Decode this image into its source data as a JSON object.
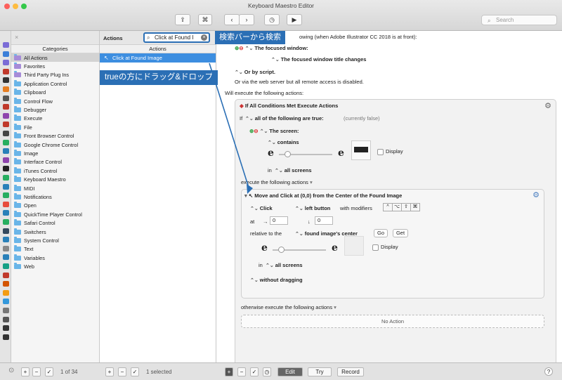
{
  "window": {
    "title": "Keyboard Maestro Editor",
    "toolbar": {
      "share_icon": "share-icon",
      "cmd_icon": "⌘",
      "back_icon": "‹",
      "fwd_icon": "›",
      "clock_icon": "clock-icon",
      "run_icon": "▶"
    },
    "search_placeholder": "Search"
  },
  "groups": {
    "header_close": "×",
    "column": "Categories",
    "items": [
      "All Actions",
      "Favorites",
      "Third Party Plug Ins",
      "Application Control",
      "Clipboard",
      "Control Flow",
      "Debugger",
      "Execute",
      "File",
      "Front Browser Control",
      "Google Chrome Control",
      "Image",
      "Interface Control",
      "iTunes Control",
      "Keyboard Maestro",
      "MIDI",
      "Notifications",
      "Open",
      "QuickTime Player Control",
      "Safari Control",
      "Switchers",
      "System Control",
      "Text",
      "Variables",
      "Web"
    ],
    "selected": "All Actions"
  },
  "actions": {
    "header": "Actions",
    "column": "Actions",
    "search_value": "Click at Found I",
    "found": "Click at Found Image"
  },
  "callouts": {
    "search": "検索バーから検索",
    "drag": "trueの方にドラッグ&ドロップ"
  },
  "editor": {
    "trigger_line": "owing (when Adobe Illustrator CC 2018 is at front):",
    "focused_window": "The focused window:",
    "title_changes": "The focused window title changes",
    "by_script": "Or by script.",
    "web_server": "Or via the web server but all remote access is disabled.",
    "will_execute": "Will execute the following actions:",
    "if_title": "If All Conditions Met Execute Actions",
    "if_prefix": "If",
    "all_of": "all of the following are true:",
    "currently": "(currently false)",
    "the_screen": "The screen:",
    "contains": "contains",
    "display": "Display",
    "in_label": "in",
    "all_screens": "all screens",
    "execute_following": "execute the following actions",
    "move_title": "Move and Click at (0,0) from the Center of the Found Image",
    "click": "Click",
    "left_button": "left button",
    "with_modifiers": "with modifiers",
    "modifier_keys": [
      "^",
      "⌥",
      "⇧",
      "⌘"
    ],
    "at": "at",
    "x_value": "0",
    "y_value": "0",
    "relative_to": "relative to the",
    "found_center": "found image's center",
    "go": "Go",
    "get": "Get",
    "display2": "Display",
    "in2": "in",
    "all_screens2": "all screens",
    "without_dragging": "without dragging",
    "otherwise": "otherwise execute the following actions",
    "no_action": "No Action"
  },
  "bottom": {
    "count": "1 of 34",
    "selected": "1 selected",
    "edit": "Edit",
    "try": "Try",
    "record": "Record",
    "help": "?"
  }
}
